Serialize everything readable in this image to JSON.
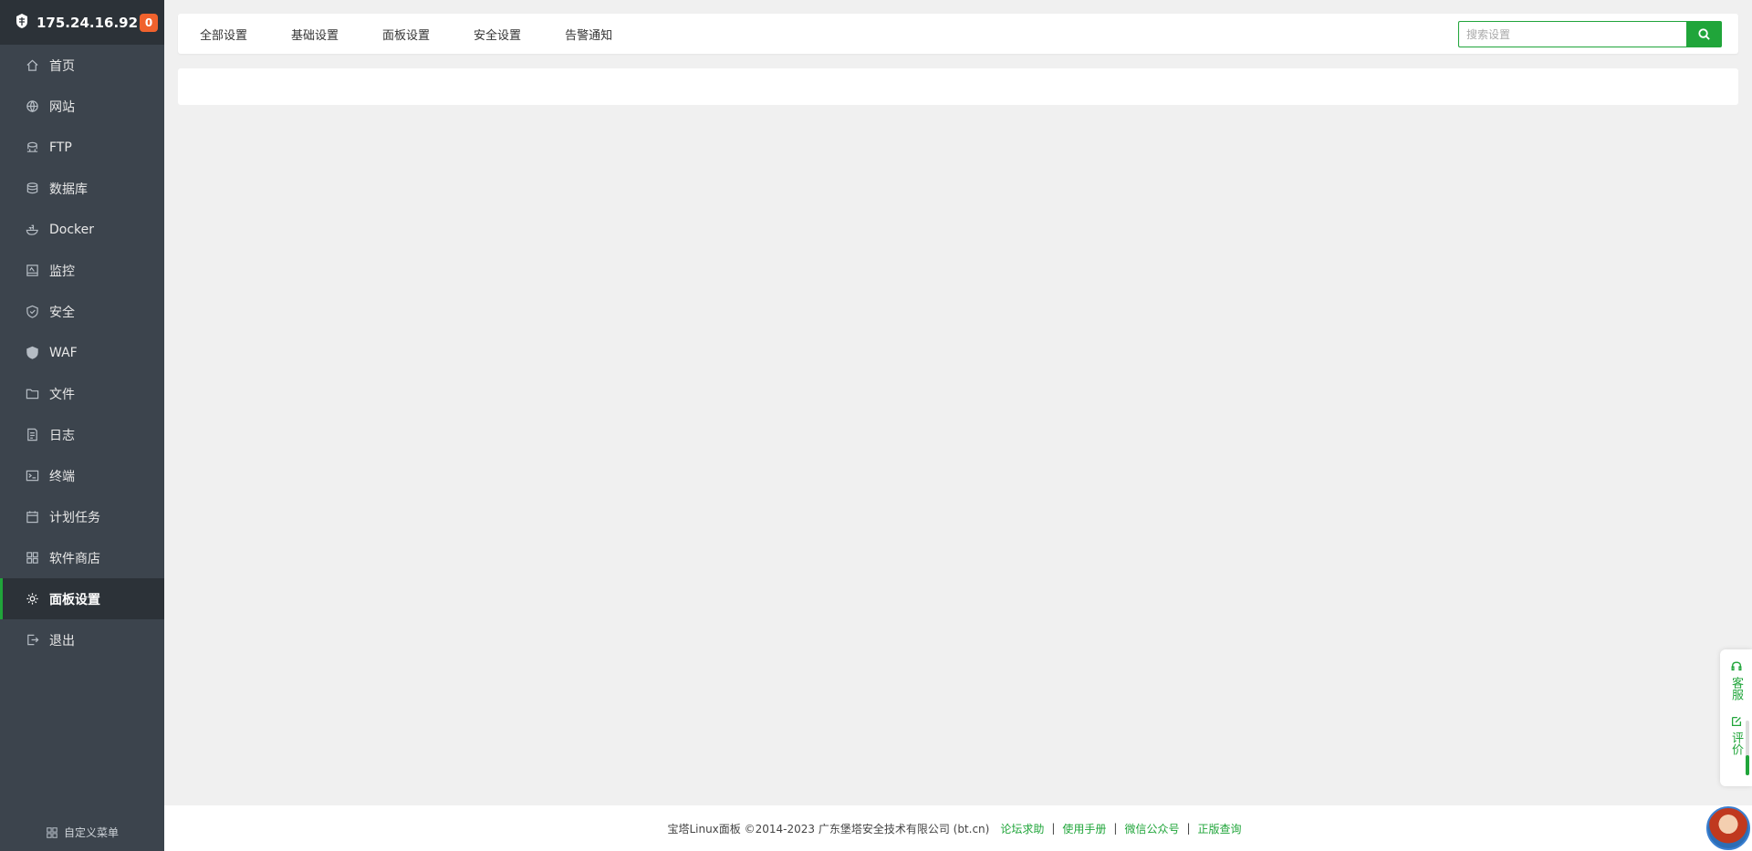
{
  "server": {
    "ip": "175.24.16.92",
    "badge_count": "0"
  },
  "sidebar": {
    "items": [
      {
        "label": "首页",
        "icon": "home-icon"
      },
      {
        "label": "网站",
        "icon": "globe-icon"
      },
      {
        "label": "FTP",
        "icon": "ftp-icon"
      },
      {
        "label": "数据库",
        "icon": "database-icon"
      },
      {
        "label": "Docker",
        "icon": "docker-icon"
      },
      {
        "label": "监控",
        "icon": "monitor-icon"
      },
      {
        "label": "安全",
        "icon": "shield-icon"
      },
      {
        "label": "WAF",
        "icon": "waf-shield-icon"
      },
      {
        "label": "文件",
        "icon": "folder-icon"
      },
      {
        "label": "日志",
        "icon": "log-icon"
      },
      {
        "label": "终端",
        "icon": "terminal-icon"
      },
      {
        "label": "计划任务",
        "icon": "calendar-icon"
      },
      {
        "label": "软件商店",
        "icon": "apps-grid-icon"
      },
      {
        "label": "面板设置",
        "icon": "gear-icon",
        "active": true
      },
      {
        "label": "退出",
        "icon": "logout-icon"
      }
    ],
    "custom_menu_label": "自定义菜单"
  },
  "tabs": [
    "全部设置",
    "基础设置",
    "面板设置",
    "安全设置",
    "告警通知"
  ],
  "search": {
    "placeholder": "搜索设置",
    "value": ""
  },
  "footer": {
    "copyright": "宝塔Linux面板 ©2014-2023 广东堡塔安全技术有限公司 (bt.cn)",
    "links": [
      "论坛求助",
      "使用手册",
      "微信公众号",
      "正版查询"
    ]
  },
  "float_panel": {
    "service_label": "客服",
    "review_label": "评价"
  },
  "colors": {
    "accent": "#20a53a",
    "sidebar_bg": "#3c444d",
    "badge": "#f0622d"
  }
}
